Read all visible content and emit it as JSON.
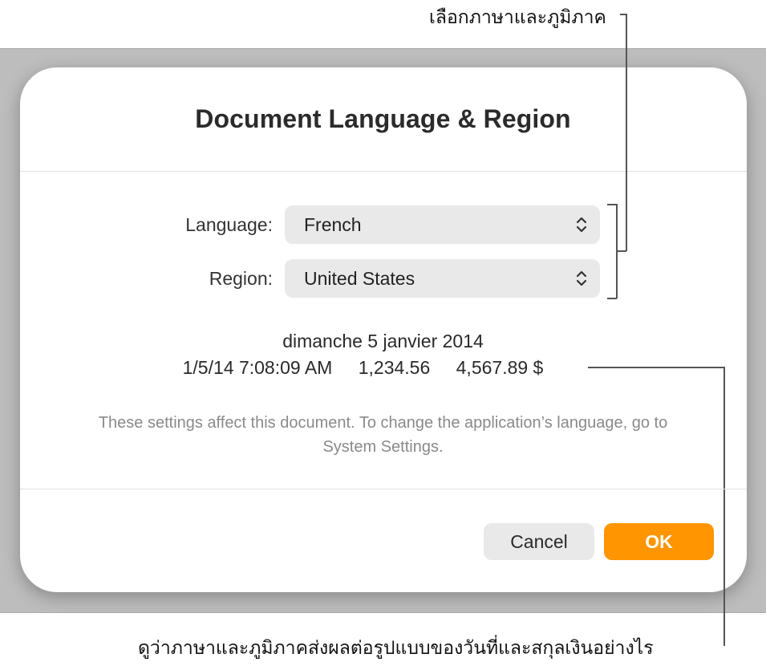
{
  "callouts": {
    "top": "เลือกภาษาและภูมิภาค",
    "bottom": "ดูว่าภาษาและภูมิภาคส่งผลต่อรูปแบบของวันที่และสกุลเงินอย่างไร"
  },
  "dialog": {
    "title": "Document Language & Region",
    "language_label": "Language:",
    "language_value": "French",
    "region_label": "Region:",
    "region_value": "United States",
    "sample_date_long": "dimanche 5 janvier 2014",
    "sample_datetime_short": "1/5/14 7:08:09 AM",
    "sample_number": "1,234.56",
    "sample_currency": "4,567.89 $",
    "note": "These settings affect this document. To change the application’s language, go to System Settings.",
    "cancel_label": "Cancel",
    "ok_label": "OK"
  },
  "colors": {
    "accent": "#ff9500",
    "popup_bg": "#e9e9e9",
    "backdrop": "#bdbdbd"
  },
  "icons": {
    "popup_chevron": "chevron-up-down-icon"
  }
}
